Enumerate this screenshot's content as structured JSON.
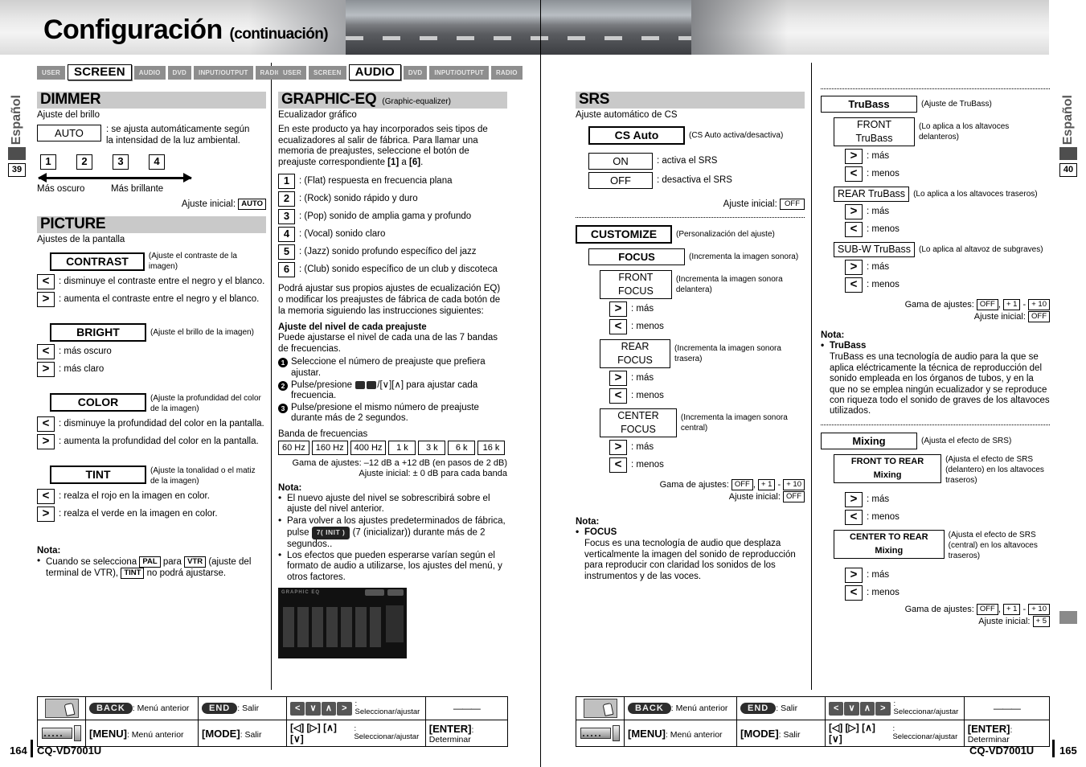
{
  "header": {
    "title": "Configuración",
    "continuation": "(continuación)"
  },
  "side_tabs": {
    "left": {
      "lang": "Español",
      "number": "39"
    },
    "right": {
      "lang": "Español",
      "number": "40"
    }
  },
  "footer_pages": {
    "left_page": "164",
    "left_model": "CQ-VD7001U",
    "right_page": "165",
    "right_model": "CQ-VD7001U"
  },
  "menu_tabs_left": [
    {
      "label": "USER",
      "active": false
    },
    {
      "label": "SCREEN",
      "active": true
    },
    {
      "label": "AUDIO",
      "active": false
    },
    {
      "label": "DVD",
      "active": false
    },
    {
      "label": "INPUT/OUTPUT",
      "active": false
    },
    {
      "label": "RADIO",
      "active": false
    }
  ],
  "menu_tabs_right": [
    {
      "label": "USER",
      "active": false
    },
    {
      "label": "SCREEN",
      "active": false
    },
    {
      "label": "AUDIO",
      "active": true
    },
    {
      "label": "DVD",
      "active": false
    },
    {
      "label": "INPUT/OUTPUT",
      "active": false
    },
    {
      "label": "RADIO",
      "active": false
    }
  ],
  "dimmer": {
    "title": "DIMMER",
    "desc": "Ajuste del brillo",
    "auto_button": "AUTO",
    "auto_desc": ": se ajusta automáticamente según la intensidad de la luz ambiental.",
    "levels": [
      "1",
      "2",
      "3",
      "4"
    ],
    "label_dark": "Más oscuro",
    "label_bright": "Más brillante",
    "initial_label": "Ajuste inicial:",
    "initial_value": "AUTO"
  },
  "picture": {
    "title": "PICTURE",
    "desc": "Ajustes de la pantalla",
    "items": [
      {
        "button": "CONTRAST",
        "note": "(Ajuste el contraste de la imagen)",
        "options": [
          {
            "key": "<",
            "text": ": disminuye el contraste entre el negro y el blanco."
          },
          {
            "key": ">",
            "text": ": aumenta el contraste entre el negro y el blanco."
          }
        ]
      },
      {
        "button": "BRIGHT",
        "note": "(Ajuste el brillo de la imagen)",
        "options": [
          {
            "key": "<",
            "text": ": más oscuro"
          },
          {
            "key": ">",
            "text": ": más claro"
          }
        ]
      },
      {
        "button": "COLOR",
        "note": "(Ajuste la profundidad del color de la imagen)",
        "options": [
          {
            "key": "<",
            "text": ": disminuye la profundidad del color en la pantalla."
          },
          {
            "key": ">",
            "text": ": aumenta la profundidad del color en la pantalla."
          }
        ]
      },
      {
        "button": "TINT",
        "note": "(Ajuste la tonalidad o el matiz de la imagen)",
        "options": [
          {
            "key": "<",
            "text": ": realza el rojo en la imagen en color."
          },
          {
            "key": ">",
            "text": ": realza el verde en la imagen en color."
          }
        ]
      }
    ],
    "note_title": "Nota:",
    "note_p1": "Cuando se selecciona",
    "note_tag1": "PAL",
    "note_p2": "para",
    "note_tag2": "VTR",
    "note_p3": "(ajuste del terminal de VTR),",
    "note_tag3": "TINT",
    "note_p4": "no podrá ajustarse."
  },
  "graphic_eq": {
    "title": "GRAPHIC-EQ",
    "subtitle": "(Graphic-equalizer)",
    "desc": "Ecualizador gráfico",
    "intro_a": "En este producto ya hay incorporados seis tipos de ecualizadores al salir de fábrica. Para llamar una memoria de preajustes, seleccione el botón de preajuste correspondiente ",
    "intro_b": "[1]",
    "intro_c": " a ",
    "intro_d": "[6]",
    "intro_e": ".",
    "presets": [
      {
        "num": "1",
        "text": ": (Flat) respuesta en frecuencia plana"
      },
      {
        "num": "2",
        "text": ": (Rock) sonido rápido y duro"
      },
      {
        "num": "3",
        "text": ": (Pop) sonido de amplia gama y profundo"
      },
      {
        "num": "4",
        "text": ": (Vocal) sonido claro"
      },
      {
        "num": "5",
        "text": ": (Jazz) sonido profundo específico del jazz"
      },
      {
        "num": "6",
        "text": ": (Club) sonido específico de un club y discoteca"
      }
    ],
    "custom_para": "Podrá ajustar sus propios ajustes de ecualización EQ) o modificar los preajustes de fábrica de cada botón de la memoria siguiendo las instrucciones siguientes:",
    "level_head": "Ajuste del nivel de cada preajuste",
    "level_para": "Puede ajustarse el nivel de cada una de las 7 bandas de frecuencias.",
    "step1": "Seleccione el número de preajuste que prefiera ajustar.",
    "step2_a": "Pulse/presione",
    "step2_b": "/[∨][∧] para ajustar cada frecuencia.",
    "step3": "Pulse/presione el mismo número de preajuste durante más de 2 segundos.",
    "band_label": "Banda de frecuencias",
    "bands": [
      "60 Hz",
      "160 Hz",
      "400 Hz",
      "1 k",
      "3 k",
      "6 k",
      "16 k"
    ],
    "range_line": "Gama de ajustes: –12 dB a +12 dB (en pasos de 2 dB)",
    "initial_line": "Ajuste inicial: ± 0 dB para cada banda",
    "note_title": "Nota:",
    "notes": [
      "El nuevo ajuste del nivel se sobrescribirá sobre el ajuste del nivel anterior.",
      "Los efectos que pueden esperarse varían según el formato de audio a utilizarse, los ajustes del menú, y otros factores."
    ],
    "note2_a": "Para volver a los ajustes predeterminados de fábrica, pulse",
    "note2_btn": "7( INIT )",
    "note2_b": "(7 (inicializar)) durante más de 2 segundos..",
    "screenshot_label": "GRAPHIC EQ"
  },
  "srs": {
    "title": "SRS",
    "desc": "Ajuste automático de CS",
    "cs_auto_button": "CS Auto",
    "cs_auto_note": "(CS Auto activa/desactiva)",
    "on_button": "ON",
    "on_text": ": activa el SRS",
    "off_button": "OFF",
    "off_text": ": desactiva el SRS",
    "initial_label": "Ajuste inicial:",
    "initial_value": "OFF",
    "customize_button": "CUSTOMIZE",
    "customize_note": "(Personalización del ajuste)",
    "focus_button": "FOCUS",
    "focus_note": "(Incrementa la imagen sonora)",
    "focus_items": [
      {
        "button": "FRONT FOCUS",
        "note": "(Incrementa la imagen sonora delantera)"
      },
      {
        "button": "REAR FOCUS",
        "note": "(Incrementa la imagen sonora trasera)"
      },
      {
        "button": "CENTER FOCUS",
        "note": "(Incrementa la imagen sonora central)"
      }
    ],
    "more_text": ": más",
    "less_text": ": menos",
    "range_label": "Gama de ajustes:",
    "range_off": "OFF",
    "range_p1": "+ 1",
    "range_p10": "+ 10",
    "range_initial_label": "Ajuste inicial:",
    "range_initial_value": "OFF",
    "note_title": "Nota:",
    "note_sub": "FOCUS",
    "note_body": "Focus es una tecnología de audio que desplaza verticalmente la imagen del sonido de reproducción para reproducir con claridad los sonidos de los instrumentos y de las voces."
  },
  "trubass": {
    "title_button": "TruBass",
    "title_note": "(Ajuste de TruBass)",
    "items": [
      {
        "button": "FRONT TruBass",
        "note": "(Lo aplica a los altavoces delanteros)"
      },
      {
        "button": "REAR TruBass",
        "note": "(Lo aplica a los altavoces traseros)"
      },
      {
        "button": "SUB-W TruBass",
        "note": "(Lo aplica al altavoz de subgraves)"
      }
    ],
    "more_text": ": más",
    "less_text": ": menos",
    "range_label": "Gama de ajustes:",
    "range_off": "OFF",
    "range_p1": "+ 1",
    "range_p10": "+ 10",
    "range_initial_label": "Ajuste inicial:",
    "range_initial_value": "OFF",
    "note_title": "Nota:",
    "note_sub": "TruBass",
    "note_body": "TruBass es una tecnología de audio para la que se aplica eléctricamente la técnica de reproducción del sonido empleada en los órganos de tubos, y en la que no se emplea ningún ecualizador y se reproduce con riqueza todo el sonido de graves de los altavoces utilizados."
  },
  "mixing": {
    "title_button": "Mixing",
    "title_note": "(Ajusta el efecto de SRS)",
    "items": [
      {
        "button": "FRONT TO REAR Mixing",
        "note": "(Ajusta el efecto de SRS (delantero) en los altavoces traseros)"
      },
      {
        "button": "CENTER TO REAR Mixing",
        "note": "(Ajusta el efecto de SRS (central) en los altavoces traseros)"
      }
    ],
    "more_text": ": más",
    "less_text": ": menos",
    "range_label": "Gama de ajustes:",
    "range_off": "OFF",
    "range_p1": "+ 1",
    "range_p10": "+ 10",
    "range_initial_label": "Ajuste inicial:",
    "range_initial_value": "+ 5"
  },
  "control_table": {
    "row1": {
      "back_key": "BACK",
      "back_label": ": Menú anterior",
      "end_key": "END",
      "end_label": ": Salir",
      "arrows": [
        "<",
        "∨",
        "∧",
        ">"
      ],
      "arrows_label": ": Seleccionar/ajustar",
      "last": "———"
    },
    "row2": {
      "menu_key": "[MENU]",
      "menu_label": ": Menú anterior",
      "mode_key": "[MODE]",
      "mode_label": ": Salir",
      "arrows_key": "[◁] [▷] [∧] [∨]",
      "arrows_label": ": Seleccionar/ajustar",
      "enter_key": "[ENTER]",
      "enter_label": ": Determinar"
    }
  }
}
